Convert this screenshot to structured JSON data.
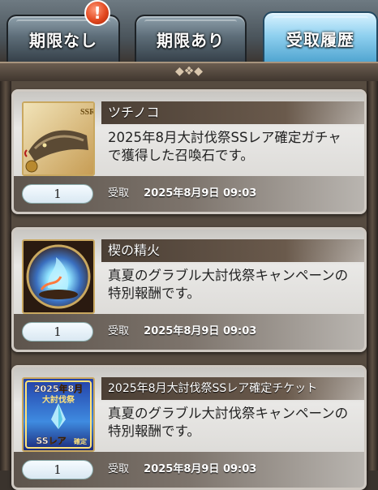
{
  "tabs": [
    {
      "label": "期限なし",
      "active": false,
      "has_badge": true
    },
    {
      "label": "期限あり",
      "active": false,
      "has_badge": false
    },
    {
      "label": "受取履歴",
      "active": true,
      "has_badge": false
    }
  ],
  "badge_symbol": "!",
  "items": [
    {
      "name": "ツチノコ",
      "description": "2025年8月大討伐祭SSレア確定ガチャで獲得した召喚石です。",
      "quantity": "1",
      "status": "受取",
      "date": "2025年8月9日 09:03",
      "icon": "snake-summon-icon",
      "rarity": "SSR"
    },
    {
      "name": "楔の精火",
      "description": "真夏のグラブル大討伐祭キャンペーンの特別報酬です。",
      "quantity": "1",
      "status": "受取",
      "date": "2025年8月9日 09:03",
      "icon": "flame-orb-icon"
    },
    {
      "name": "2025年8月大討伐祭SSレア確定チケット",
      "description": "真夏のグラブル大討伐祭キャンペーンの特別報酬です。",
      "quantity": "1",
      "status": "受取",
      "date": "2025年8月9日 09:03",
      "icon": "ticket-icon",
      "ticket_text": [
        "2025年8月",
        "大討伐祭",
        "SSレア",
        "確定"
      ]
    }
  ],
  "colors": {
    "active_tab": "#8fd0ef",
    "inactive_tab": "#5d6d78",
    "badge": "#e2481f",
    "card_bg": "#e9e8e6"
  }
}
